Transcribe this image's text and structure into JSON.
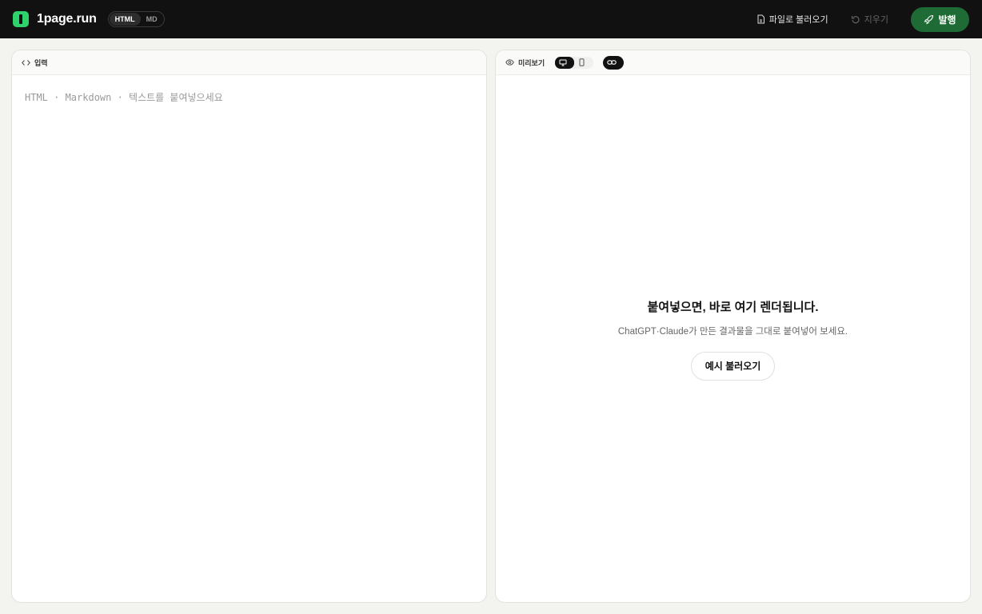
{
  "header": {
    "brand": "1page.run",
    "modes": [
      "HTML",
      "MD"
    ],
    "active_mode": "HTML",
    "load_file_label": "파일로 불러오기",
    "clear_label": "지우기",
    "publish_label": "발행"
  },
  "editor": {
    "title": "입력",
    "placeholder": "HTML · Markdown · 텍스트를 붙여넣으세요"
  },
  "preview": {
    "title": "미리보기",
    "empty_title": "붙여넣으면, 바로 여기 렌더됩니다.",
    "empty_subtitle": "ChatGPT·Claude가 만든 결과물을 그대로 붙여넣어 보세요.",
    "example_button": "예시 불러오기"
  },
  "colors": {
    "accent": "#2fd36b",
    "publish": "#1e6b35",
    "topbar": "#111111"
  }
}
